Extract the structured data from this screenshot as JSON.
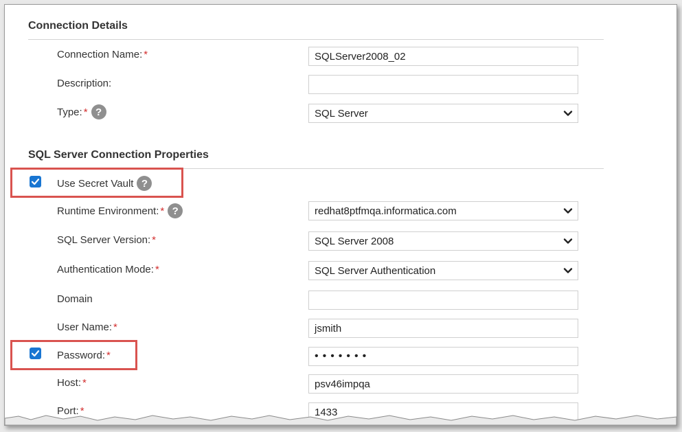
{
  "sections": {
    "details_title": "Connection Details",
    "props_title": "SQL Server Connection Properties"
  },
  "fields": {
    "connection_name": {
      "label": "Connection Name:",
      "value": "SQLServer2008_02",
      "required": "*"
    },
    "description": {
      "label": "Description:",
      "value": ""
    },
    "type": {
      "label": "Type:",
      "value": "SQL Server",
      "required": "*",
      "help_icon": "question-circle-icon"
    },
    "secret_vault": {
      "label": "Use Secret Vault",
      "checked": true,
      "help_icon": "question-circle-icon"
    },
    "runtime_env": {
      "label": "Runtime Environment:",
      "value": "redhat8ptfmqa.informatica.com",
      "required": "*",
      "help_icon": "question-circle-icon"
    },
    "sql_version": {
      "label": "SQL Server Version:",
      "value": "SQL Server 2008",
      "required": "*"
    },
    "auth_mode": {
      "label": "Authentication Mode:",
      "value": "SQL Server Authentication",
      "required": "*"
    },
    "domain": {
      "label": "Domain",
      "value": ""
    },
    "user_name": {
      "label": "User Name:",
      "value": "jsmith",
      "required": "*"
    },
    "password": {
      "label": "Password:",
      "value": "•••••••",
      "required": "*",
      "checked": true
    },
    "host": {
      "label": "Host:",
      "value": "psv46impqa",
      "required": "*"
    },
    "port": {
      "label": "Port:",
      "value": "1433",
      "required": "*"
    }
  },
  "help_glyph": "?",
  "colors": {
    "checkbox": "#1976d2",
    "required": "#d32f2f",
    "highlight": "#d9534f",
    "help_icon": "#8f8f8f"
  }
}
